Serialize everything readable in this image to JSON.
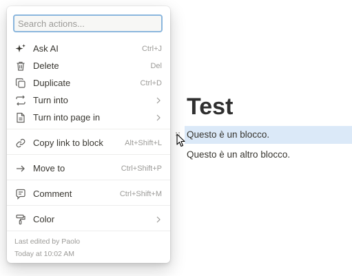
{
  "page": {
    "title": "Test",
    "blocks": [
      "Questo è un blocco.",
      "Questo è un altro blocco."
    ]
  },
  "menu": {
    "search_placeholder": "Search actions...",
    "items": [
      {
        "label": "Ask AI",
        "shortcut": "Ctrl+J",
        "icon": "sparkle-icon"
      },
      {
        "label": "Delete",
        "shortcut": "Del",
        "icon": "trash-icon"
      },
      {
        "label": "Duplicate",
        "shortcut": "Ctrl+D",
        "icon": "duplicate-icon"
      },
      {
        "label": "Turn into",
        "shortcut": "",
        "icon": "turn-into-icon",
        "submenu": true
      },
      {
        "label": "Turn into page in",
        "shortcut": "",
        "icon": "page-icon",
        "submenu": true
      },
      {
        "label": "Copy link to block",
        "shortcut": "Alt+Shift+L",
        "icon": "link-icon"
      },
      {
        "label": "Move to",
        "shortcut": "Ctrl+Shift+P",
        "icon": "arrow-right-icon"
      },
      {
        "label": "Comment",
        "shortcut": "Ctrl+Shift+M",
        "icon": "comment-icon"
      },
      {
        "label": "Color",
        "shortcut": "",
        "icon": "paint-roller-icon",
        "submenu": true
      }
    ],
    "footer": {
      "edited_by": "Last edited by Paolo",
      "edited_at": "Today at 10:02 AM"
    }
  },
  "colors": {
    "selection": "#dbe9f8",
    "search_border": "#8ab6dd",
    "muted_text": "#9b9a97"
  }
}
